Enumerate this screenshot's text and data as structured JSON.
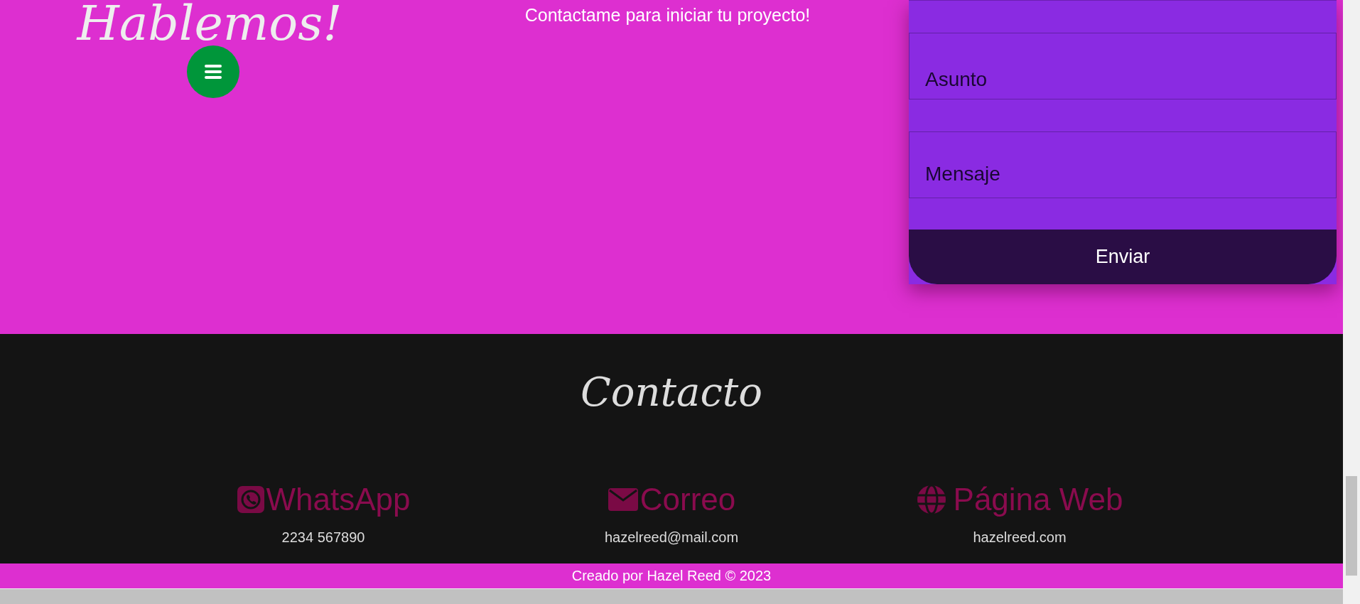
{
  "hero": {
    "title": "Hablemos!",
    "subtitle": "Contactame para iniciar tu proyecto!"
  },
  "form": {
    "fields": [
      {
        "kind": "input",
        "placeholder": "Asunto"
      },
      {
        "kind": "textarea",
        "placeholder": "Mensaje"
      }
    ],
    "submit": "Enviar"
  },
  "contact": {
    "title": "Contacto",
    "items": [
      {
        "kind": "whatsapp",
        "label": "WhatsApp",
        "value": "2234 567890"
      },
      {
        "kind": "mail",
        "label": "Correo",
        "value": "hazelreed@mail.com"
      },
      {
        "kind": "web",
        "label": "Página Web",
        "value": "hazelreed.com"
      }
    ]
  },
  "footer": {
    "text": "Creado por Hazel Reed © 2023"
  }
}
